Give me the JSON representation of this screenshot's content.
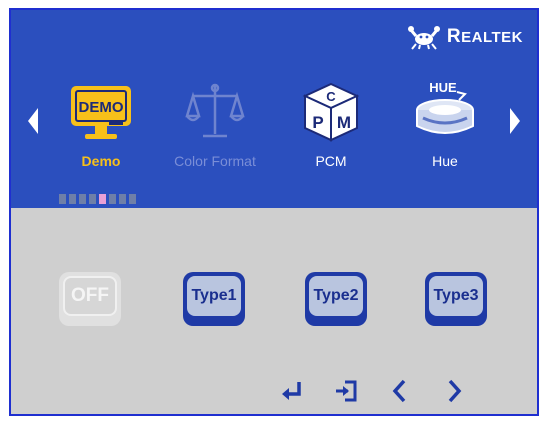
{
  "brand": {
    "name_big": "R",
    "name_small": "EALTEK"
  },
  "menu": {
    "items": [
      {
        "label": "Demo",
        "icon": "demo-monitor-icon",
        "state": "selected"
      },
      {
        "label": "Color Format",
        "icon": "scale-icon",
        "state": "disabled"
      },
      {
        "label": "PCM",
        "icon": "pcm-cube-icon",
        "state": "normal"
      },
      {
        "label": "Hue",
        "icon": "hue-icon",
        "state": "normal"
      }
    ],
    "demo_icon_text": "DEMO",
    "pcm_letters": [
      "C",
      "P",
      "M"
    ],
    "hue_text": "HUE"
  },
  "pager": {
    "total": 8,
    "active_index": 4
  },
  "options": {
    "off": "OFF",
    "type1": "Type1",
    "type2": "Type2",
    "type3": "Type3"
  },
  "colors": {
    "top_bg": "#2b4fbe",
    "bottom_bg": "#cfcfcf",
    "selected_label": "#f7c01a",
    "disabled_label": "#7a8ed7",
    "type_button": "#1f3aa6"
  }
}
